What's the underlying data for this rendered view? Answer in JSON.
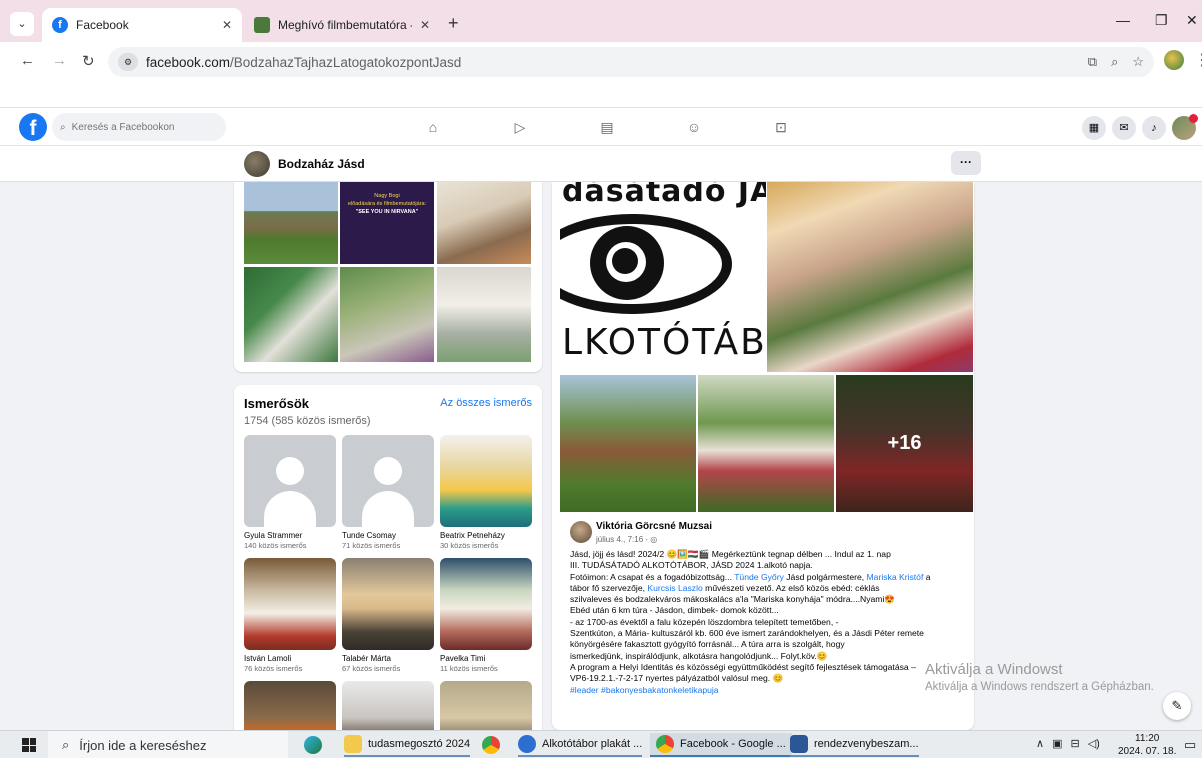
{
  "browser": {
    "tabs": [
      {
        "title": "Facebook",
        "active": true,
        "favicon": "facebook-icon"
      },
      {
        "title": "Meghívó filmbemutatóra - Jásd",
        "active": false,
        "favicon": "site-icon"
      }
    ],
    "address": {
      "domain": "facebook.com",
      "path": "/BodzahazTajhazLatogatokozpontJasd"
    }
  },
  "facebook": {
    "search_placeholder": "Keresés a Facebookon",
    "nav_icons": [
      "home-icon",
      "video-icon",
      "marketplace-icon",
      "groups-icon",
      "gaming-icon"
    ],
    "page_name": "Bodzaház Jásd",
    "more_label": "···"
  },
  "left": {
    "poster": {
      "line1": "Nagy Bogi",
      "line2": "előadására és filmbemutatójára:",
      "line3": "\"SEE YOU IN NIRVANA\""
    },
    "friends": {
      "title": "Ismerősök",
      "see_all": "Az összes ismerős",
      "count": "1754 (585 közös ismerős)",
      "items": [
        {
          "name": "Gyula Strammer",
          "mutual": "140 közös ismerős",
          "photo": "default"
        },
        {
          "name": "Tunde Csomay",
          "mutual": "71 közös ismerős",
          "photo": "default"
        },
        {
          "name": "Beatrix Petneházy",
          "mutual": "30 közös ismerős",
          "photo": "beatrix"
        },
        {
          "name": "István Lamoli",
          "mutual": "76 közös ismerős",
          "photo": "istvan"
        },
        {
          "name": "Talabér Márta",
          "mutual": "67 közös ismerős",
          "photo": "marta"
        },
        {
          "name": "Pavelka Timi",
          "mutual": "11 közös ismerős",
          "photo": "timi"
        }
      ]
    }
  },
  "post": {
    "poster_top": "dásátadó JÁS",
    "poster_bottom": "LKOTÓTÁB",
    "more_photos": "+16",
    "author": "Viktória Görcsné Muzsai",
    "time": "július 4., 7:16 · ◎",
    "lines": [
      "Jásd, jöjj és lásd! 2024/2        😊🖼️🇭🇺🎬      Megérkeztünk tegnap délben ... Indul az 1. nap",
      "III. TUDÁSÁTADÓ ALKOTÓTÁBOR, JÁSD 2024                          1.alkotó napja.",
      "Fotóimon: A csapat és a fogadóbizottság... ",
      "tábor fő szervezője, ",
      "szilvaleves és bodzalekváros mákoskalács a'la \"Mariska konyhája\" módra....Nyami😍",
      "Ebéd után 6 km túra                      - Jásdon, dimbek- domok között...",
      "- az 1700-as évektől  a falu közepén löszdombra telepített temetőben,                            -",
      "Szentkúton, a Mária- kultuszáról kb. 600 éve ismert zarándokhelyen, és a Jásdi Péter remete",
      "könyörgésére fakasztott gyógyító forrásnál...                A túra arra is szolgált, hogy",
      "ismerkedjünk, inspirálódjunk, alkotásra hangolódjunk...            Folyt.köv.😊",
      "A program a Helyi Identitás és közösségi együttműködést segítő fejlesztések támogatása –",
      "VP6-19.2.1.-7-2-17 nyertes pályázatból valósul meg. 😊",
      "#leader #bakonyesbakatonkeletikapuja"
    ],
    "mentions": {
      "mayor_name": "Tünde Győry",
      "mayor_role": " Jásd polgármestere, ",
      "organizer": "Mariska Kristóf",
      "organizer_suffix": " a",
      "leader_name": "Kurcsis Laszlo",
      "leader_role": " művészeti vezető.                Az első közös ebéd: céklás"
    }
  },
  "watermark": {
    "line1": "Aktiválja a Windowst",
    "line2": "Aktiválja a Windows rendszert a Gépházban."
  },
  "taskbar": {
    "search_placeholder": "Írjon ide a kereséshez",
    "apps": [
      {
        "label": "",
        "icon": "edge-icon"
      },
      {
        "label": "tudasmegosztó 2024",
        "icon": "folder-icon"
      },
      {
        "label": "",
        "icon": "chrome-icon"
      },
      {
        "label": "Alkotótábor plakát ...",
        "icon": "chrome-profile-icon"
      },
      {
        "label": "Facebook - Google ...",
        "icon": "chrome-profile-icon"
      },
      {
        "label": "rendezvenybeszam...",
        "icon": "word-icon"
      }
    ],
    "time": "11:20",
    "date": "2024. 07. 18."
  }
}
